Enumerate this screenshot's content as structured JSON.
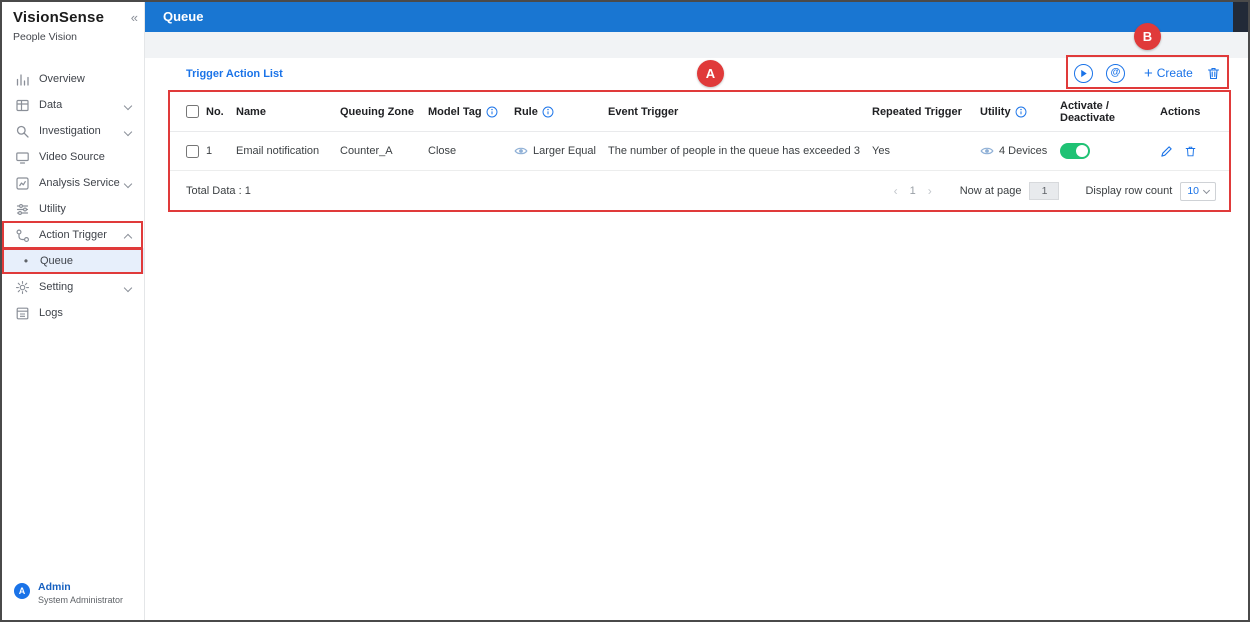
{
  "app": {
    "title": "VisionSense",
    "subtitle": "People Vision"
  },
  "icons": {
    "collapse": "«",
    "at": "@",
    "plus": "+",
    "prev": "‹",
    "next": "›",
    "bullet": "•"
  },
  "sidebar": {
    "items": [
      {
        "label": "Overview"
      },
      {
        "label": "Data"
      },
      {
        "label": "Investigation"
      },
      {
        "label": "Video Source"
      },
      {
        "label": "Analysis Service"
      },
      {
        "label": "Utility"
      },
      {
        "label": "Action Trigger"
      },
      {
        "label": "Queue"
      },
      {
        "label": "Setting"
      },
      {
        "label": "Logs"
      }
    ],
    "user": {
      "initial": "A",
      "name": "Admin",
      "role": "System Administrator"
    }
  },
  "header": {
    "title": "Queue"
  },
  "panel": {
    "title": "Trigger Action List",
    "create_label": "Create"
  },
  "table": {
    "columns": [
      "No.",
      "Name",
      "Queuing Zone",
      "Model Tag",
      "Rule",
      "Event Trigger",
      "Repeated Trigger",
      "Utility",
      "Activate / Deactivate",
      "Actions"
    ],
    "rows": [
      {
        "no": "1",
        "name": "Email notification",
        "queuing_zone": "Counter_A",
        "model_tag": "Close",
        "rule": "Larger Equal",
        "event_trigger": "The number of people in the queue has exceeded 3",
        "repeated_trigger": "Yes",
        "utility": "4 Devices",
        "active": true
      }
    ],
    "footer": {
      "total": "Total Data : 1",
      "page_number": "1",
      "now_at_page_label": "Now at page",
      "now_at_page_value": "1",
      "display_row_count_label": "Display row count",
      "display_row_count_value": "10"
    }
  },
  "annotations": {
    "a_label": "A",
    "b_label": "B"
  },
  "colors": {
    "primary_blue": "#1976d2",
    "link_blue": "#1a73e8",
    "annotation_red": "#e03a3a",
    "toggle_green": "#1fc274",
    "selected_item_bg": "#e7effb"
  }
}
